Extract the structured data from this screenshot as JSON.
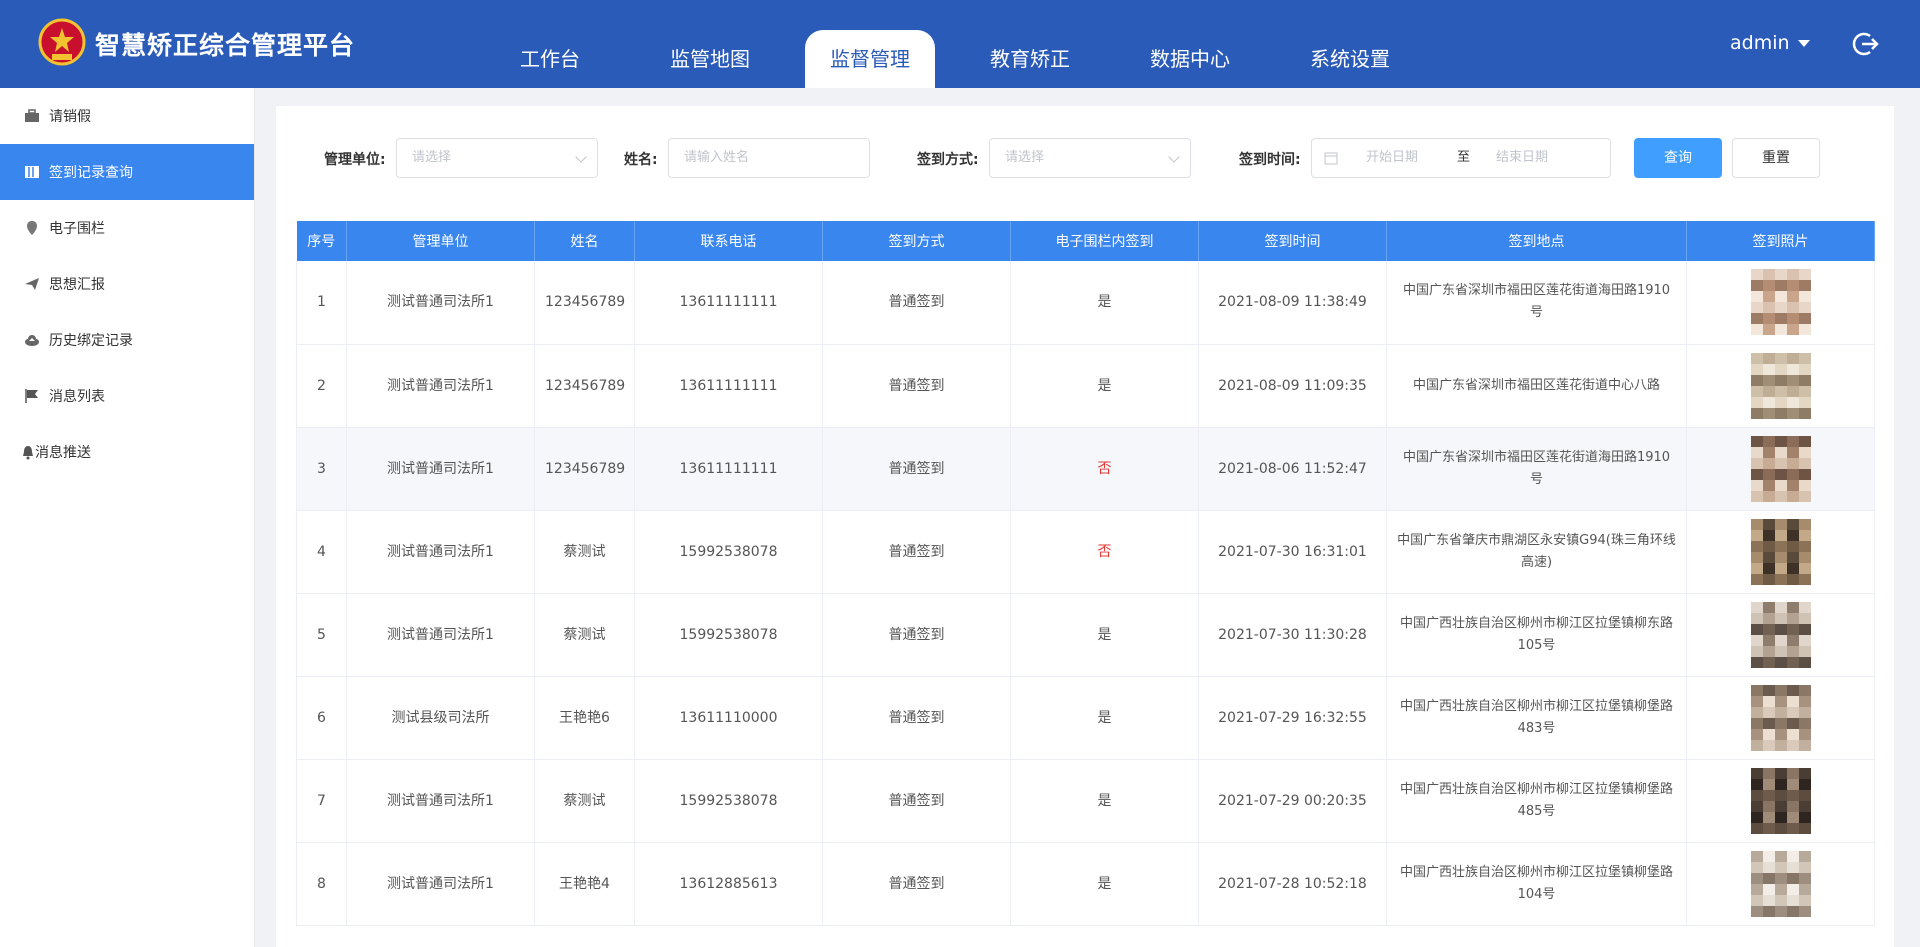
{
  "header": {
    "title": "智慧矫正综合管理平台",
    "nav": [
      {
        "label": "工作台",
        "active": false
      },
      {
        "label": "监管地图",
        "active": false
      },
      {
        "label": "监督管理",
        "active": true
      },
      {
        "label": "教育矫正",
        "active": false
      },
      {
        "label": "数据中心",
        "active": false
      },
      {
        "label": "系统设置",
        "active": false
      }
    ],
    "user": "admin"
  },
  "sidebar": {
    "items": [
      {
        "label": "请销假",
        "icon": "briefcase-icon",
        "active": false
      },
      {
        "label": "签到记录查询",
        "icon": "book-icon",
        "active": true
      },
      {
        "label": "电子围栏",
        "icon": "location-pin-icon",
        "active": false
      },
      {
        "label": "思想汇报",
        "icon": "send-icon",
        "active": false
      },
      {
        "label": "历史绑定记录",
        "icon": "cloud-upload-icon",
        "active": false
      },
      {
        "label": "消息列表",
        "icon": "flag-icon",
        "active": false
      },
      {
        "label": "消息推送",
        "icon": "bell-icon",
        "active": false
      }
    ]
  },
  "filter": {
    "unit_label": "管理单位:",
    "unit_placeholder": "请选择",
    "name_label": "姓名:",
    "name_placeholder": "请输入姓名",
    "method_label": "签到方式:",
    "method_placeholder": "请选择",
    "time_label": "签到时间:",
    "start_placeholder": "开始日期",
    "range_sep": "至",
    "end_placeholder": "结束日期",
    "search_button": "查询",
    "reset_button": "重置"
  },
  "table": {
    "columns": [
      "序号",
      "管理单位",
      "姓名",
      "联系电话",
      "签到方式",
      "电子围栏内签到",
      "签到时间",
      "签到地点",
      "签到照片"
    ],
    "rows": [
      {
        "no": "1",
        "unit": "测试普通司法所1",
        "name": "123456789",
        "phone": "13611111111",
        "method": "普通签到",
        "in_fence": "是",
        "time": "2021-08-09 11:38:49",
        "place": "中国广东省深圳市福田区莲花街道海田路1910号"
      },
      {
        "no": "2",
        "unit": "测试普通司法所1",
        "name": "123456789",
        "phone": "13611111111",
        "method": "普通签到",
        "in_fence": "是",
        "time": "2021-08-09 11:09:35",
        "place": "中国广东省深圳市福田区莲花街道中心八路"
      },
      {
        "no": "3",
        "unit": "测试普通司法所1",
        "name": "123456789",
        "phone": "13611111111",
        "method": "普通签到",
        "in_fence": "否",
        "time": "2021-08-06 11:52:47",
        "place": "中国广东省深圳市福田区莲花街道海田路1910号"
      },
      {
        "no": "4",
        "unit": "测试普通司法所1",
        "name": "蔡测试",
        "phone": "15992538078",
        "method": "普通签到",
        "in_fence": "否",
        "time": "2021-07-30 16:31:01",
        "place": "中国广东省肇庆市鼎湖区永安镇G94(珠三角环线高速)"
      },
      {
        "no": "5",
        "unit": "测试普通司法所1",
        "name": "蔡测试",
        "phone": "15992538078",
        "method": "普通签到",
        "in_fence": "是",
        "time": "2021-07-30 11:30:28",
        "place": "中国广西壮族自治区柳州市柳江区拉堡镇柳东路105号"
      },
      {
        "no": "6",
        "unit": "测试县级司法所",
        "name": "王艳艳6",
        "phone": "13611110000",
        "method": "普通签到",
        "in_fence": "是",
        "time": "2021-07-29 16:32:55",
        "place": "中国广西壮族自治区柳州市柳江区拉堡镇柳堡路483号"
      },
      {
        "no": "7",
        "unit": "测试普通司法所1",
        "name": "蔡测试",
        "phone": "15992538078",
        "method": "普通签到",
        "in_fence": "是",
        "time": "2021-07-29 00:20:35",
        "place": "中国广西壮族自治区柳州市柳江区拉堡镇柳堡路485号"
      },
      {
        "no": "8",
        "unit": "测试普通司法所1",
        "name": "王艳艳4",
        "phone": "13612885613",
        "method": "普通签到",
        "in_fence": "是",
        "time": "2021-07-28 10:52:18",
        "place": "中国广西壮族自治区柳州市柳江区拉堡镇柳堡路104号"
      }
    ]
  },
  "colors": {
    "header": "#2b5bb8",
    "accent": "#3a86ef",
    "no": "#e53935"
  }
}
